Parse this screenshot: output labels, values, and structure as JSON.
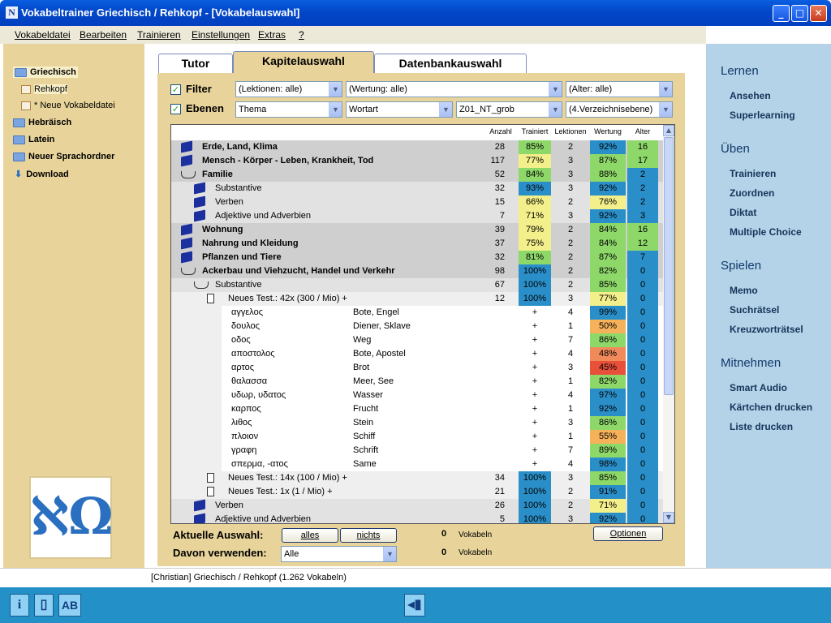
{
  "window": {
    "title": "Vokabeltrainer Griechisch / Rehkopf - [Vokabelauswahl]",
    "app_icon": "N"
  },
  "menu": [
    "Vokabeldatei",
    "Bearbeiten",
    "Trainieren",
    "Einstellungen",
    "Extras",
    "?"
  ],
  "tree": [
    {
      "label": "Griechisch",
      "icon": "folder-open-icon"
    },
    {
      "label": "Rehkopf",
      "icon": "book-icon"
    },
    {
      "label": "* Neue Vokabeldatei",
      "icon": "book-icon"
    },
    {
      "label": "Hebräisch",
      "icon": "folder-icon"
    },
    {
      "label": "Latein",
      "icon": "folder-icon"
    },
    {
      "label": "Neuer Sprachordner",
      "icon": "folder-icon"
    },
    {
      "label": "Download",
      "icon": "download-arrow-icon"
    }
  ],
  "logo_glyph": "ℵΩ",
  "tabs": [
    "Tutor",
    "Kapitelauswahl",
    "Datenbankauswahl"
  ],
  "filter": {
    "filter_label": "Filter",
    "ebenen_label": "Ebenen",
    "filter_lektionen": "(Lektionen: alle)",
    "filter_wertung": "(Wertung: alle)",
    "filter_alter": "(Alter: alle)",
    "ebene_1": "Thema",
    "ebene_2": "Wortart",
    "ebene_3": "Z01_NT_grob",
    "ebene_4": "(4.Verzeichnisebene)"
  },
  "columns": [
    "Anzahl",
    "Trainiert",
    "Lektionen",
    "Wertung",
    "Alter"
  ],
  "rows": [
    {
      "name": "Erde, Land, Klima",
      "lvl": 0,
      "icon": "book",
      "bold": true,
      "anzahl": "28",
      "trainiert": "85%",
      "lektionen": "2",
      "wertung": "92%",
      "alter": "16",
      "tc": "#8ed86a",
      "wc": "#2a8fc9",
      "ac": "#8ed86a"
    },
    {
      "name": "Mensch - Körper - Leben, Krankheit, Tod",
      "lvl": 0,
      "icon": "book",
      "bold": true,
      "anzahl": "117",
      "trainiert": "77%",
      "lektionen": "3",
      "wertung": "87%",
      "alter": "17",
      "tc": "#f3ef8a",
      "wc": "#8ed86a",
      "ac": "#8ed86a"
    },
    {
      "name": "Familie",
      "lvl": 0,
      "icon": "open",
      "bold": true,
      "anzahl": "52",
      "trainiert": "84%",
      "lektionen": "3",
      "wertung": "88%",
      "alter": "2",
      "tc": "#8ed86a",
      "wc": "#8ed86a",
      "ac": "#2a8fc9"
    },
    {
      "name": "Substantive",
      "lvl": 1,
      "icon": "book",
      "bold": false,
      "anzahl": "32",
      "trainiert": "93%",
      "lektionen": "3",
      "wertung": "92%",
      "alter": "2",
      "tc": "#2a8fc9",
      "wc": "#2a8fc9",
      "ac": "#2a8fc9"
    },
    {
      "name": "Verben",
      "lvl": 1,
      "icon": "book",
      "bold": false,
      "anzahl": "15",
      "trainiert": "66%",
      "lektionen": "2",
      "wertung": "76%",
      "alter": "2",
      "tc": "#f3ef8a",
      "wc": "#f3ef8a",
      "ac": "#2a8fc9"
    },
    {
      "name": "Adjektive und Adverbien",
      "lvl": 1,
      "icon": "book",
      "bold": false,
      "anzahl": "7",
      "trainiert": "71%",
      "lektionen": "3",
      "wertung": "92%",
      "alter": "3",
      "tc": "#f3ef8a",
      "wc": "#2a8fc9",
      "ac": "#2a8fc9"
    },
    {
      "name": "Wohnung",
      "lvl": 0,
      "icon": "book",
      "bold": true,
      "anzahl": "39",
      "trainiert": "79%",
      "lektionen": "2",
      "wertung": "84%",
      "alter": "16",
      "tc": "#f3ef8a",
      "wc": "#8ed86a",
      "ac": "#8ed86a"
    },
    {
      "name": "Nahrung und Kleidung",
      "lvl": 0,
      "icon": "book",
      "bold": true,
      "anzahl": "37",
      "trainiert": "75%",
      "lektionen": "2",
      "wertung": "84%",
      "alter": "12",
      "tc": "#f3ef8a",
      "wc": "#8ed86a",
      "ac": "#8ed86a"
    },
    {
      "name": "Pflanzen und Tiere",
      "lvl": 0,
      "icon": "book",
      "bold": true,
      "anzahl": "32",
      "trainiert": "81%",
      "lektionen": "2",
      "wertung": "87%",
      "alter": "7",
      "tc": "#8ed86a",
      "wc": "#8ed86a",
      "ac": "#2a8fc9"
    },
    {
      "name": "Ackerbau und Viehzucht, Handel und Verkehr",
      "lvl": 0,
      "icon": "open",
      "bold": true,
      "anzahl": "98",
      "trainiert": "100%",
      "lektionen": "2",
      "wertung": "82%",
      "alter": "0",
      "tc": "#2a8fc9",
      "wc": "#8ed86a",
      "ac": "#2a8fc9"
    },
    {
      "name": "Substantive",
      "lvl": 1,
      "icon": "open",
      "bold": false,
      "anzahl": "67",
      "trainiert": "100%",
      "lektionen": "2",
      "wertung": "85%",
      "alter": "0",
      "tc": "#2a8fc9",
      "wc": "#8ed86a",
      "ac": "#2a8fc9"
    },
    {
      "name": "Neues Test.: 42x  (300 / Mio) +",
      "lvl": 2,
      "icon": "page",
      "bold": false,
      "anzahl": "12",
      "trainiert": "100%",
      "lektionen": "3",
      "wertung": "77%",
      "alter": "0",
      "tc": "#2a8fc9",
      "wc": "#f3ef8a",
      "ac": "#2a8fc9"
    }
  ],
  "vocab": [
    {
      "gr": "αγγελος",
      "de": "Bote, Engel",
      "tr": "+",
      "lek": "4",
      "wertung": "99%",
      "alter": "0",
      "wc": "#2a8fc9"
    },
    {
      "gr": "δουλος",
      "de": "Diener, Sklave",
      "tr": "+",
      "lek": "1",
      "wertung": "50%",
      "alter": "0",
      "wc": "#f6b25a"
    },
    {
      "gr": "οδος",
      "de": "Weg",
      "tr": "+",
      "lek": "7",
      "wertung": "86%",
      "alter": "0",
      "wc": "#8ed86a"
    },
    {
      "gr": "αποστολος",
      "de": "Bote, Apostel",
      "tr": "+",
      "lek": "4",
      "wertung": "48%",
      "alter": "0",
      "wc": "#f08a5a"
    },
    {
      "gr": "αρτος",
      "de": "Brot",
      "tr": "+",
      "lek": "3",
      "wertung": "45%",
      "alter": "0",
      "wc": "#e8503a"
    },
    {
      "gr": "θαλασσα",
      "de": "Meer, See",
      "tr": "+",
      "lek": "1",
      "wertung": "82%",
      "alter": "0",
      "wc": "#8ed86a"
    },
    {
      "gr": "υδωρ, υδατος",
      "de": "Wasser",
      "tr": "+",
      "lek": "4",
      "wertung": "97%",
      "alter": "0",
      "wc": "#2a8fc9"
    },
    {
      "gr": "καρπος",
      "de": "Frucht",
      "tr": "+",
      "lek": "1",
      "wertung": "92%",
      "alter": "0",
      "wc": "#2a8fc9"
    },
    {
      "gr": "λιθος",
      "de": "Stein",
      "tr": "+",
      "lek": "3",
      "wertung": "86%",
      "alter": "0",
      "wc": "#8ed86a"
    },
    {
      "gr": "πλοιον",
      "de": "Schiff",
      "tr": "+",
      "lek": "1",
      "wertung": "55%",
      "alter": "0",
      "wc": "#f6b25a"
    },
    {
      "gr": "γραφη",
      "de": "Schrift",
      "tr": "+",
      "lek": "7",
      "wertung": "89%",
      "alter": "0",
      "wc": "#8ed86a"
    },
    {
      "gr": "σπερμα, -ατος",
      "de": "Same",
      "tr": "+",
      "lek": "4",
      "wertung": "98%",
      "alter": "0",
      "wc": "#2a8fc9"
    }
  ],
  "rows_after": [
    {
      "name": "Neues Test.: 14x  (100 / Mio) +",
      "lvl": 2,
      "icon": "page",
      "bold": false,
      "anzahl": "34",
      "trainiert": "100%",
      "lektionen": "3",
      "wertung": "85%",
      "alter": "0",
      "tc": "#2a8fc9",
      "wc": "#8ed86a",
      "ac": "#2a8fc9"
    },
    {
      "name": "Neues Test.:   1x  (1 / Mio) +",
      "lvl": 2,
      "icon": "page",
      "bold": false,
      "anzahl": "21",
      "trainiert": "100%",
      "lektionen": "2",
      "wertung": "91%",
      "alter": "0",
      "tc": "#2a8fc9",
      "wc": "#2a8fc9",
      "ac": "#2a8fc9"
    },
    {
      "name": "Verben",
      "lvl": 1,
      "icon": "book",
      "bold": false,
      "anzahl": "26",
      "trainiert": "100%",
      "lektionen": "2",
      "wertung": "71%",
      "alter": "0",
      "tc": "#2a8fc9",
      "wc": "#f3ef8a",
      "ac": "#2a8fc9"
    },
    {
      "name": "Adjektive und Adverbien",
      "lvl": 1,
      "icon": "book",
      "bold": false,
      "anzahl": "5",
      "trainiert": "100%",
      "lektionen": "3",
      "wertung": "92%",
      "alter": "0",
      "tc": "#2a8fc9",
      "wc": "#2a8fc9",
      "ac": "#2a8fc9"
    }
  ],
  "bottom": {
    "aktuelle_label": "Aktuelle Auswahl:",
    "alles": "alles",
    "nichts": "nichts",
    "count1": "0",
    "vokabeln1": "Vokabeln",
    "davon_label": "Davon verwenden:",
    "davon_value": "Alle",
    "count2": "0",
    "vokabeln2": "Vokabeln",
    "optionen": "Optionen"
  },
  "right": {
    "sections": [
      {
        "title": "Lernen",
        "items": [
          "Ansehen",
          "Superlearning"
        ]
      },
      {
        "title": "Üben",
        "items": [
          "Trainieren",
          "Zuordnen",
          "Diktat",
          "Multiple Choice"
        ]
      },
      {
        "title": "Spielen",
        "items": [
          "Memo",
          "Suchrätsel",
          "Kreuzworträtsel"
        ]
      },
      {
        "title": "Mitnehmen",
        "items": [
          "Smart Audio",
          "Kärtchen drucken",
          "Liste drucken"
        ]
      }
    ]
  },
  "status": "[Christian]  Griechisch / Rehkopf  (1.262 Vokabeln)",
  "toolbar": {
    "info": "i",
    "ab": "AB"
  }
}
